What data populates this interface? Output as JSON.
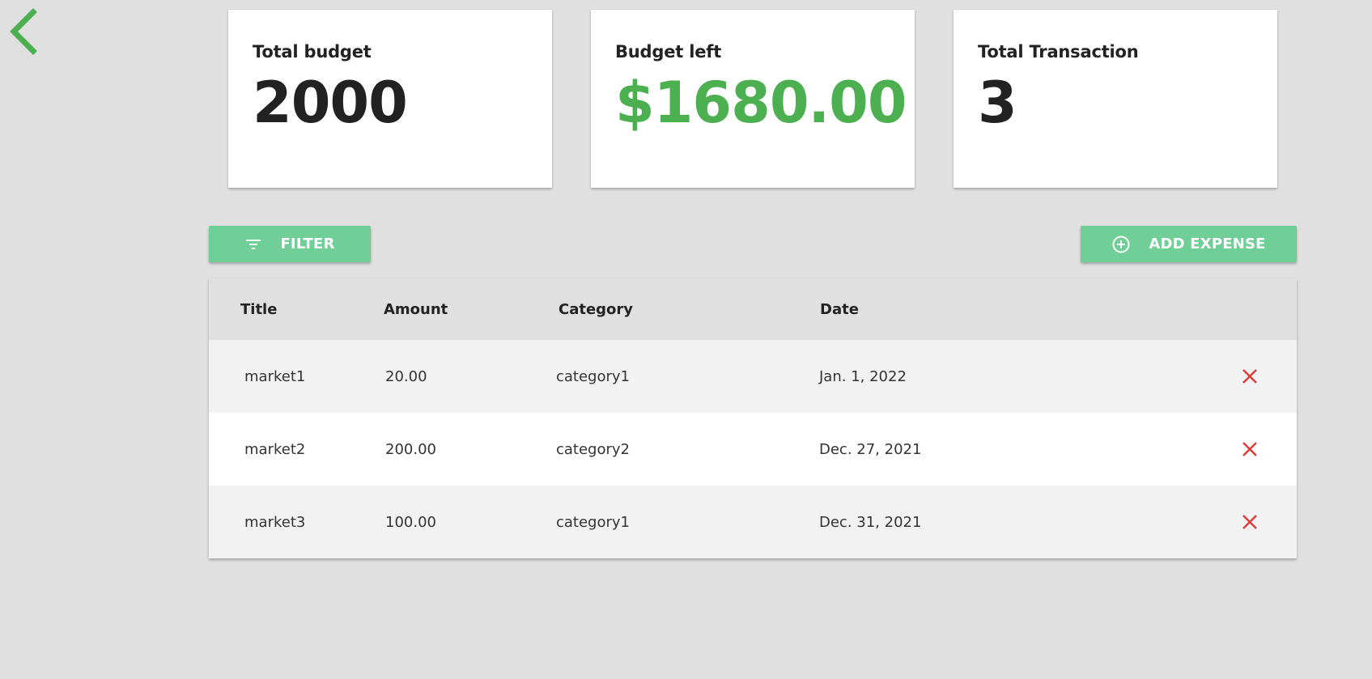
{
  "nav": {
    "back_icon": "chevron-left-icon",
    "accent": "#4caf50"
  },
  "cards": [
    {
      "label": "Total budget",
      "value": "2000"
    },
    {
      "label": "Budget left",
      "value": "$1680.00",
      "color": "#4caf50"
    },
    {
      "label": "Total Transaction",
      "value": "3"
    }
  ],
  "toolbar": {
    "filter_label": "FILTER",
    "filter_icon": "filter-icon",
    "add_label": "ADD EXPENSE",
    "add_icon": "plus-circle-icon",
    "button_color": "#6fcf97"
  },
  "table": {
    "columns": [
      "Title",
      "Amount",
      "Category",
      "Date"
    ],
    "rows": [
      {
        "title": "market1",
        "amount": "20.00",
        "category": "category1",
        "date": "Jan. 1, 2022"
      },
      {
        "title": "market2",
        "amount": "200.00",
        "category": "category2",
        "date": "Dec. 27, 2021"
      },
      {
        "title": "market3",
        "amount": "100.00",
        "category": "category1",
        "date": "Dec. 31, 2021"
      }
    ],
    "delete_icon": "close-icon",
    "delete_color": "#e53935"
  }
}
